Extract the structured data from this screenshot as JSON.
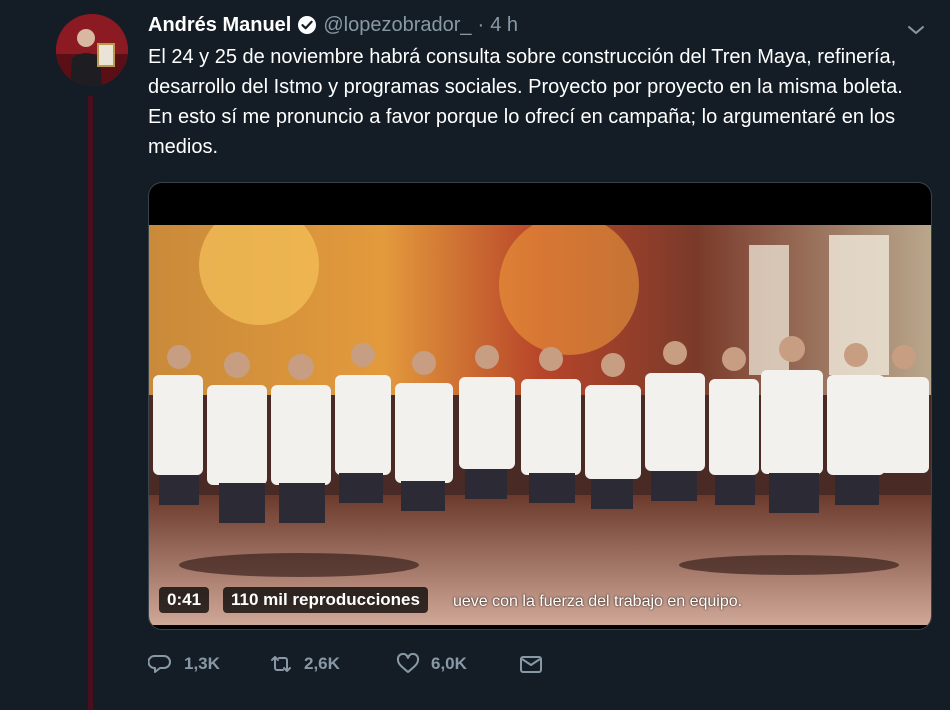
{
  "tweet": {
    "author_name": "Andrés Manuel",
    "handle": "@lopezobrador_",
    "separator": "·",
    "time": "4 h",
    "text": "El 24 y 25 de noviembre habrá consulta sobre construcción del Tren Maya, refinería, desarrollo del Istmo y programas sociales. Proyecto por proyecto en la misma boleta. En esto sí me pronuncio a favor porque lo ofrecí en campaña; lo argumentaré en los medios."
  },
  "video": {
    "duration": "0:41",
    "views": "110 mil reproducciones",
    "caption": "ueve con la fuerza del trabajo en equipo."
  },
  "actions": {
    "replies": "1,3K",
    "retweets": "2,6K",
    "likes": "6,0K"
  },
  "icons": {
    "reply": "reply-icon",
    "retweet": "retweet-icon",
    "like": "heart-icon",
    "dm": "envelope-icon",
    "verified": "verified-badge-icon",
    "menu": "chevron-down-icon"
  },
  "colors": {
    "background": "#141d26",
    "secondary_text": "#8899a6",
    "verified": "#ffffff",
    "thread_line": "#4a0f1c"
  }
}
